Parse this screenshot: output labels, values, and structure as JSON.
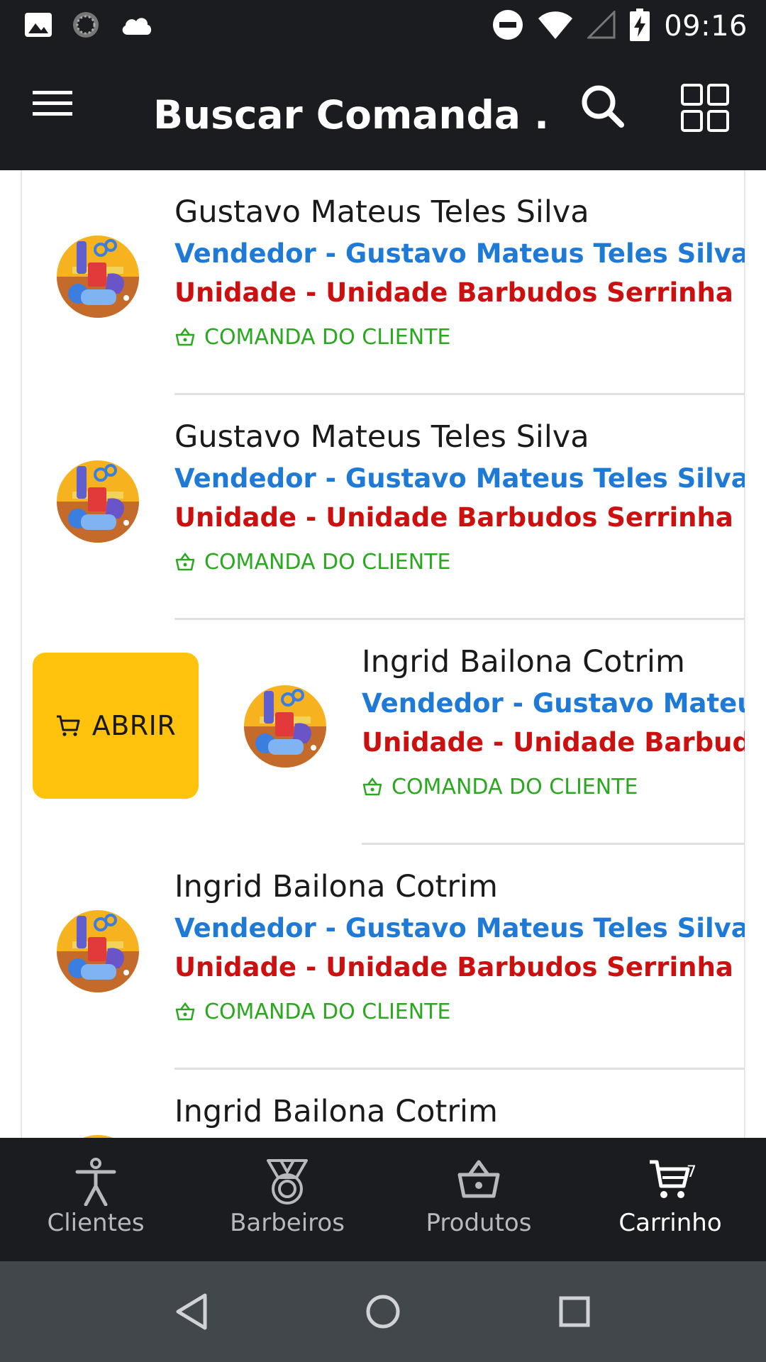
{
  "status_bar": {
    "time": "09:16",
    "left_icons": [
      "image-icon",
      "loading-icon",
      "cloud-icon"
    ],
    "right_icons": [
      "do-not-disturb-icon",
      "wifi-icon",
      "signal-icon",
      "battery-charging-icon"
    ]
  },
  "app_bar": {
    "title": "Buscar Comanda .",
    "icons": [
      "menu-icon",
      "search-icon",
      "grid-view-icon"
    ]
  },
  "list": {
    "open_action_label": "ABRIR",
    "items": [
      {
        "name": "Gustavo Mateus Teles Silva",
        "vendor": "Vendedor - Gustavo Mateus Teles Silva",
        "unit": "Unidade - Unidade Barbudos Serrinha",
        "tag": "COMANDA DO CLIENTE"
      },
      {
        "name": "Gustavo Mateus Teles Silva",
        "vendor": "Vendedor - Gustavo Mateus Teles Silva",
        "unit": "Unidade - Unidade Barbudos Serrinha",
        "tag": "COMANDA DO CLIENTE"
      },
      {
        "name": "Ingrid Bailona Cotrim",
        "vendor": "Vendedor - Gustavo Mateus Teles Silva",
        "unit": "Unidade - Unidade Barbudos Serrinha",
        "tag": "COMANDA DO CLIENTE",
        "swiped": true
      },
      {
        "name": "Ingrid Bailona Cotrim",
        "vendor": "Vendedor - Gustavo Mateus Teles Silva",
        "unit": "Unidade - Unidade Barbudos Serrinha",
        "tag": "COMANDA DO CLIENTE"
      },
      {
        "name": "Ingrid Bailona Cotrim"
      }
    ]
  },
  "bottom_nav": {
    "items": [
      {
        "label": "Clientes",
        "icon": "person-icon"
      },
      {
        "label": "Barbeiros",
        "icon": "medal-icon"
      },
      {
        "label": "Produtos",
        "icon": "basket-icon"
      },
      {
        "label": "Carrinho",
        "icon": "cart-icon",
        "active": true
      }
    ],
    "cart_count": "7"
  },
  "colors": {
    "bar_bg": "#1b1c20",
    "vendor_blue": "#1e7ad6",
    "unit_red": "#cc1010",
    "tag_green": "#2aa81f",
    "action_yellow": "#ffc30d",
    "system_nav_bg": "#42474b"
  }
}
